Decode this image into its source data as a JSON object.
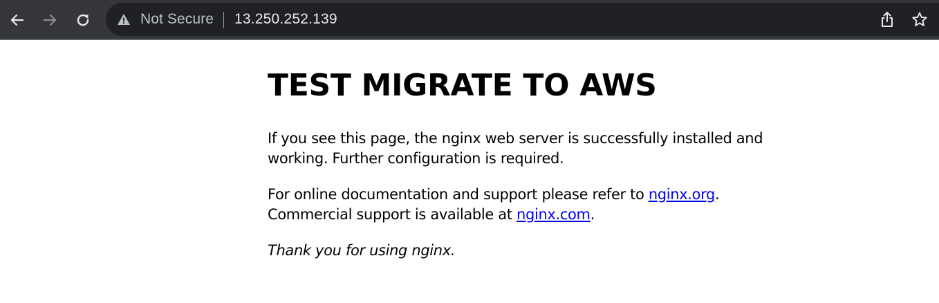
{
  "browser": {
    "nav": {
      "back_icon": "arrow-left-icon",
      "forward_icon": "arrow-right-icon",
      "reload_icon": "reload-icon"
    },
    "omnibox": {
      "security_icon": "warning-triangle-icon",
      "security_label": "Not Secure",
      "url": "13.250.252.139",
      "share_icon": "share-icon",
      "bookmark_icon": "star-icon"
    },
    "colors": {
      "toolbar": "#35363a",
      "omnibox": "#202124",
      "link": "#0000ee"
    }
  },
  "page": {
    "heading": "TEST MIGRATE TO AWS",
    "paragraph1": "If you see this page, the nginx web server is successfully installed and working. Further configuration is required.",
    "paragraph2": {
      "text_before_link1": "For online documentation and support please refer to ",
      "link1": "nginx.org",
      "text_after_link1": ".",
      "text_before_link2": "Commercial support is available at ",
      "link2": "nginx.com",
      "text_after_link2": "."
    },
    "paragraph3": "Thank you for using nginx."
  }
}
